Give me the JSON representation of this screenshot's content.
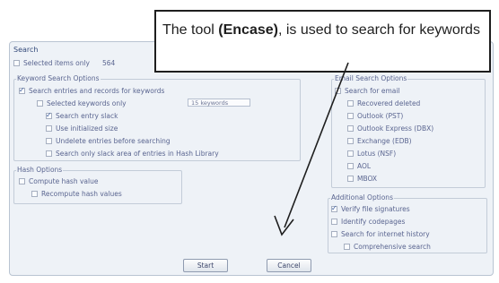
{
  "callout": {
    "text_before": "The tool ",
    "text_bold": "(Encase)",
    "text_after": ", is used to search for keywords"
  },
  "window": {
    "title": "Search",
    "selected_items_only": "Selected items only",
    "selected_items_count": "564",
    "keyword_search_options": {
      "label": "Keyword Search Options",
      "search_entries": "Search entries and records for keywords",
      "selected_keywords_only": "Selected keywords only",
      "keywords_count": "15 keywords",
      "search_entry_slack": "Search entry slack",
      "use_initialized_size": "Use initialized size",
      "undelete_entries": "Undelete entries before searching",
      "search_only_slack": "Search only slack area of entries in Hash Library"
    },
    "hash_options": {
      "label": "Hash Options",
      "compute_hash": "Compute hash value",
      "recompute_hash": "Recompute hash values"
    },
    "email_search_options": {
      "label": "Email Search Options",
      "search_for_email": "Search for email",
      "recovered_deleted": "Recovered deleted",
      "outlook_pst": "Outlook (PST)",
      "outlook_express": "Outlook Express (DBX)",
      "exchange": "Exchange (EDB)",
      "lotus": "Lotus (NSF)",
      "aol": "AOL",
      "mbox": "MBOX"
    },
    "additional_options": {
      "label": "Additional Options",
      "verify_signatures": "Verify file signatures",
      "identify_codepages": "Identify codepages",
      "search_internet_history": "Search for internet history",
      "comprehensive_search": "Comprehensive search"
    },
    "start_button": "Start",
    "cancel_button": "Cancel"
  }
}
